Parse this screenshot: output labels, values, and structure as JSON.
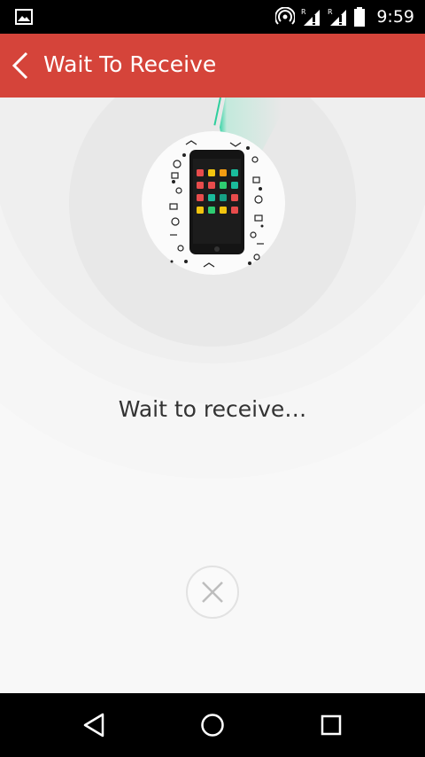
{
  "status_bar": {
    "time": "9:59",
    "icons": [
      "gallery-icon",
      "hotspot-icon",
      "signal-r-icon",
      "signal-r-icon",
      "battery-icon"
    ]
  },
  "app_bar": {
    "title": "Wait To Receive",
    "background": "#d5443a",
    "back_icon": "chevron-left-icon"
  },
  "main": {
    "status_text": "Wait to receive…",
    "illustration": "phone-with-app-icons",
    "cancel_icon": "close-icon",
    "scan_color": "#2ecf9d"
  },
  "nav_bar": {
    "icons": [
      "back-triangle-icon",
      "home-circle-icon",
      "recents-square-icon"
    ]
  }
}
